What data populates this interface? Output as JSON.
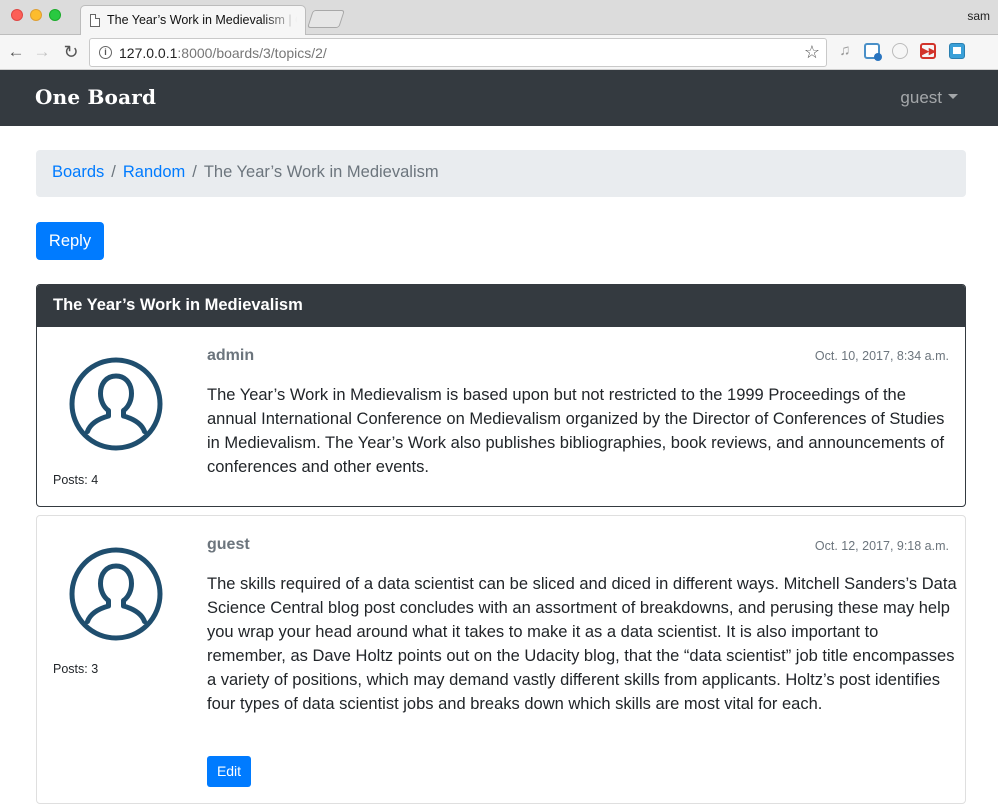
{
  "browser": {
    "tab_title": "The Year’s Work in Medievalism | One Board",
    "profile_name": "sam",
    "url_host": "127.0.0.1",
    "url_rest": ":8000/boards/3/topics/2/"
  },
  "navbar": {
    "brand": "One Board",
    "user": "guest"
  },
  "breadcrumb": {
    "items": [
      "Boards",
      "Random"
    ],
    "active": "The Year’s Work in Medievalism"
  },
  "actions": {
    "reply_label": "Reply"
  },
  "topic": {
    "title": "The Year’s Work in Medievalism"
  },
  "posts": [
    {
      "author": "admin",
      "date": "Oct. 10, 2017, 8:34 a.m.",
      "posts_count": "Posts: 4",
      "message": "The Year’s Work in Medievalism is based upon but not restricted to the 1999 Proceedings of the annual International Conference on Medievalism organized by the Director of Conferences of Studies in Medievalism. The Year’s Work also publishes bibliographies, book reviews, and announcements of conferences and other events."
    },
    {
      "author": "guest",
      "date": "Oct. 12, 2017, 9:18 a.m.",
      "posts_count": "Posts: 3",
      "message": "The skills required of a data scientist can be sliced and diced in different ways. Mitchell Sanders’s Data Science Central blog post concludes with an assortment of breakdowns, and perusing these may help you wrap your head around what it takes to make it as a data scientist. It is also important to remember, as Dave Holtz points out on the Udacity blog, that the “data scientist” job title encompasses a variety of positions, which may demand vastly different skills from applicants. Holtz’s post identifies four types of data scientist jobs and breaks down which skills are most vital for each.",
      "edit_label": "Edit"
    }
  ],
  "colors": {
    "primary": "#007bff",
    "dark": "#343a40",
    "muted": "#6c757d",
    "avatar": "#1f4e6e"
  }
}
